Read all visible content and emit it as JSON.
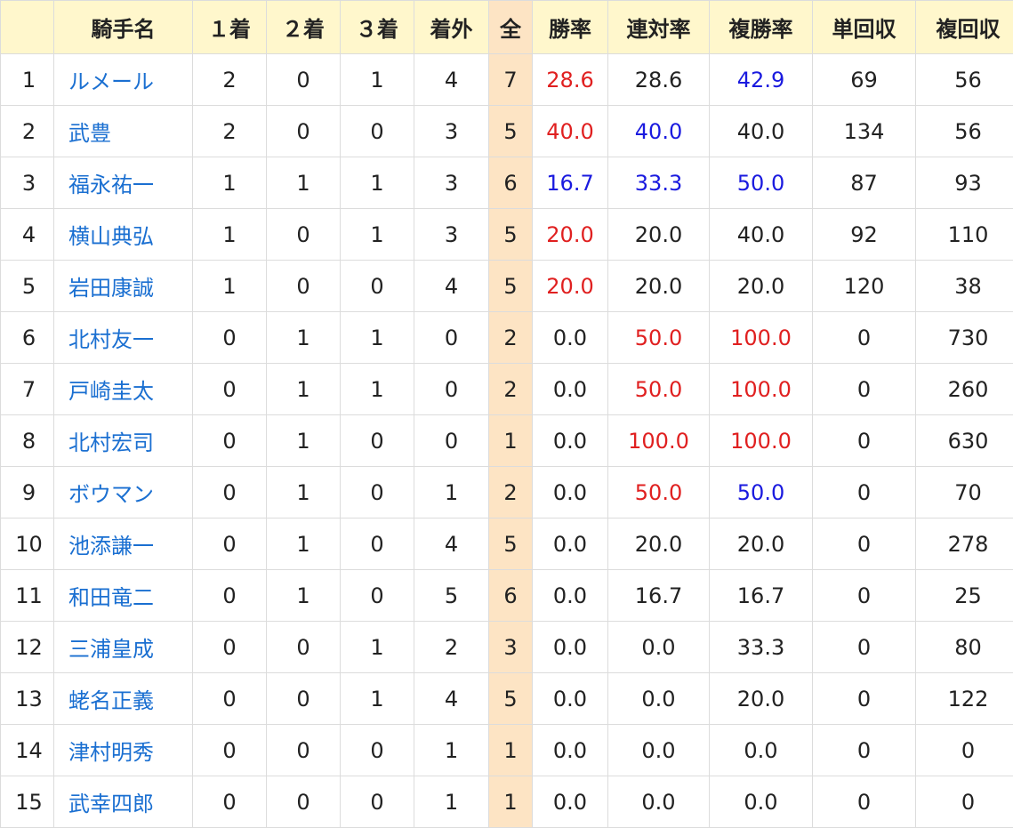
{
  "headers": [
    "",
    "騎手名",
    "１着",
    "２着",
    "３着",
    "着外",
    "全",
    "勝率",
    "連対率",
    "複勝率",
    "単回収",
    "複回収"
  ],
  "colors": {
    "red": "#e02020",
    "blue": "#1a1adf",
    "link": "#1a6fd1",
    "header_bg": "#fff7cc",
    "total_bg": "#fde4c4"
  },
  "rows": [
    {
      "rank": "1",
      "name": "ルメール",
      "first": "2",
      "second": "0",
      "third": "1",
      "out": "4",
      "total": "7",
      "win": "28.6",
      "quinella": "28.6",
      "place": "42.9",
      "win_return": "69",
      "place_return": "56",
      "win_c": "red",
      "quinella_c": "",
      "place_c": "blue"
    },
    {
      "rank": "2",
      "name": "武豊",
      "first": "2",
      "second": "0",
      "third": "0",
      "out": "3",
      "total": "5",
      "win": "40.0",
      "quinella": "40.0",
      "place": "40.0",
      "win_return": "134",
      "place_return": "56",
      "win_c": "red",
      "quinella_c": "blue",
      "place_c": ""
    },
    {
      "rank": "3",
      "name": "福永祐一",
      "first": "1",
      "second": "1",
      "third": "1",
      "out": "3",
      "total": "6",
      "win": "16.7",
      "quinella": "33.3",
      "place": "50.0",
      "win_return": "87",
      "place_return": "93",
      "win_c": "blue",
      "quinella_c": "blue",
      "place_c": "blue"
    },
    {
      "rank": "4",
      "name": "横山典弘",
      "first": "1",
      "second": "0",
      "third": "1",
      "out": "3",
      "total": "5",
      "win": "20.0",
      "quinella": "20.0",
      "place": "40.0",
      "win_return": "92",
      "place_return": "110",
      "win_c": "red",
      "quinella_c": "",
      "place_c": ""
    },
    {
      "rank": "5",
      "name": "岩田康誠",
      "first": "1",
      "second": "0",
      "third": "0",
      "out": "4",
      "total": "5",
      "win": "20.0",
      "quinella": "20.0",
      "place": "20.0",
      "win_return": "120",
      "place_return": "38",
      "win_c": "red",
      "quinella_c": "",
      "place_c": ""
    },
    {
      "rank": "6",
      "name": "北村友一",
      "first": "0",
      "second": "1",
      "third": "1",
      "out": "0",
      "total": "2",
      "win": "0.0",
      "quinella": "50.0",
      "place": "100.0",
      "win_return": "0",
      "place_return": "730",
      "win_c": "",
      "quinella_c": "red",
      "place_c": "red"
    },
    {
      "rank": "7",
      "name": "戸崎圭太",
      "first": "0",
      "second": "1",
      "third": "1",
      "out": "0",
      "total": "2",
      "win": "0.0",
      "quinella": "50.0",
      "place": "100.0",
      "win_return": "0",
      "place_return": "260",
      "win_c": "",
      "quinella_c": "red",
      "place_c": "red"
    },
    {
      "rank": "8",
      "name": "北村宏司",
      "first": "0",
      "second": "1",
      "third": "0",
      "out": "0",
      "total": "1",
      "win": "0.0",
      "quinella": "100.0",
      "place": "100.0",
      "win_return": "0",
      "place_return": "630",
      "win_c": "",
      "quinella_c": "red",
      "place_c": "red"
    },
    {
      "rank": "9",
      "name": "ボウマン",
      "first": "0",
      "second": "1",
      "third": "0",
      "out": "1",
      "total": "2",
      "win": "0.0",
      "quinella": "50.0",
      "place": "50.0",
      "win_return": "0",
      "place_return": "70",
      "win_c": "",
      "quinella_c": "red",
      "place_c": "blue"
    },
    {
      "rank": "10",
      "name": "池添謙一",
      "first": "0",
      "second": "1",
      "third": "0",
      "out": "4",
      "total": "5",
      "win": "0.0",
      "quinella": "20.0",
      "place": "20.0",
      "win_return": "0",
      "place_return": "278",
      "win_c": "",
      "quinella_c": "",
      "place_c": ""
    },
    {
      "rank": "11",
      "name": "和田竜二",
      "first": "0",
      "second": "1",
      "third": "0",
      "out": "5",
      "total": "6",
      "win": "0.0",
      "quinella": "16.7",
      "place": "16.7",
      "win_return": "0",
      "place_return": "25",
      "win_c": "",
      "quinella_c": "",
      "place_c": ""
    },
    {
      "rank": "12",
      "name": "三浦皇成",
      "first": "0",
      "second": "0",
      "third": "1",
      "out": "2",
      "total": "3",
      "win": "0.0",
      "quinella": "0.0",
      "place": "33.3",
      "win_return": "0",
      "place_return": "80",
      "win_c": "",
      "quinella_c": "",
      "place_c": ""
    },
    {
      "rank": "13",
      "name": "蛯名正義",
      "first": "0",
      "second": "0",
      "third": "1",
      "out": "4",
      "total": "5",
      "win": "0.0",
      "quinella": "0.0",
      "place": "20.0",
      "win_return": "0",
      "place_return": "122",
      "win_c": "",
      "quinella_c": "",
      "place_c": ""
    },
    {
      "rank": "14",
      "name": "津村明秀",
      "first": "0",
      "second": "0",
      "third": "0",
      "out": "1",
      "total": "1",
      "win": "0.0",
      "quinella": "0.0",
      "place": "0.0",
      "win_return": "0",
      "place_return": "0",
      "win_c": "",
      "quinella_c": "",
      "place_c": ""
    },
    {
      "rank": "15",
      "name": "武幸四郎",
      "first": "0",
      "second": "0",
      "third": "0",
      "out": "1",
      "total": "1",
      "win": "0.0",
      "quinella": "0.0",
      "place": "0.0",
      "win_return": "0",
      "place_return": "0",
      "win_c": "",
      "quinella_c": "",
      "place_c": ""
    }
  ]
}
